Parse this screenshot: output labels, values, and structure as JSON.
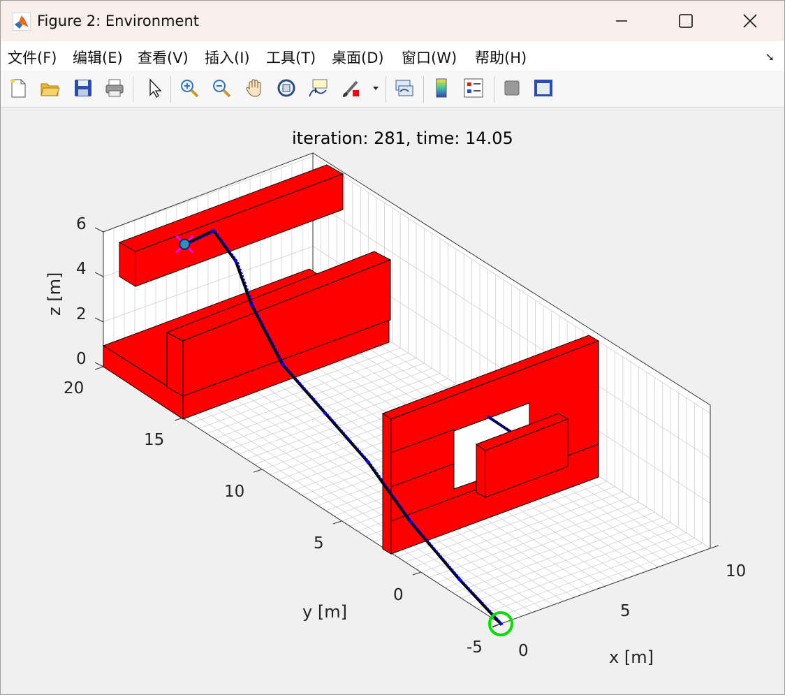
{
  "window": {
    "title": "Figure 2: Environment"
  },
  "menu": [
    "文件(F)",
    "编辑(E)",
    "查看(V)",
    "插入(I)",
    "工具(T)",
    "桌面(D)",
    "窗口(W)",
    "帮助(H)"
  ],
  "toolbar": {
    "buttons": [
      "new-figure-icon",
      "open-file-icon",
      "save-icon",
      "print-icon",
      "pointer-icon",
      "zoom-in-icon",
      "zoom-out-icon",
      "pan-hand-icon",
      "rotate-3d-icon",
      "data-cursor-icon",
      "brush-icon",
      "brush-dropdown-icon",
      "link-plot-icon",
      "colorbar-icon",
      "legend-icon",
      "hide-plot-tools-icon",
      "show-plot-tools-icon"
    ]
  },
  "plot": {
    "title": "iteration: 281, time: 14.05",
    "xlabel": "x [m]",
    "ylabel": "y [m]",
    "zlabel": "z [m]",
    "x_ticks": [
      "0",
      "5",
      "10"
    ],
    "y_ticks": [
      "-5",
      "0",
      "5",
      "10",
      "15",
      "20"
    ],
    "z_ticks": [
      "0",
      "2",
      "4",
      "6"
    ]
  },
  "chart_data": {
    "type": "scatter",
    "title": "iteration: 281, time: 14.05",
    "xlabel": "x [m]",
    "ylabel": "y [m]",
    "zlabel": "z [m]",
    "xlim": [
      0,
      10
    ],
    "ylim": [
      -5,
      20
    ],
    "zlim": [
      0,
      6
    ],
    "grid": true,
    "colors": {
      "obstacle": "#ff0000",
      "reference_path": "#000000",
      "trajectory": "#0000ff",
      "start_marker": "#00dd00",
      "goal_marker": "#ff00ff"
    },
    "series": [
      {
        "values": [
          [
            0,
            -5,
            0
          ],
          [
            0.3,
            -2,
            0.5
          ],
          [
            1,
            2,
            1
          ],
          [
            2,
            6,
            1.5
          ],
          [
            3,
            10,
            1.5
          ],
          [
            4,
            14,
            1.5
          ],
          [
            4.8,
            17,
            2.5
          ],
          [
            4.8,
            18,
            4
          ],
          [
            4.5,
            19,
            5
          ],
          [
            3.5,
            19.5,
            4.5
          ]
        ]
      }
    ]
  }
}
